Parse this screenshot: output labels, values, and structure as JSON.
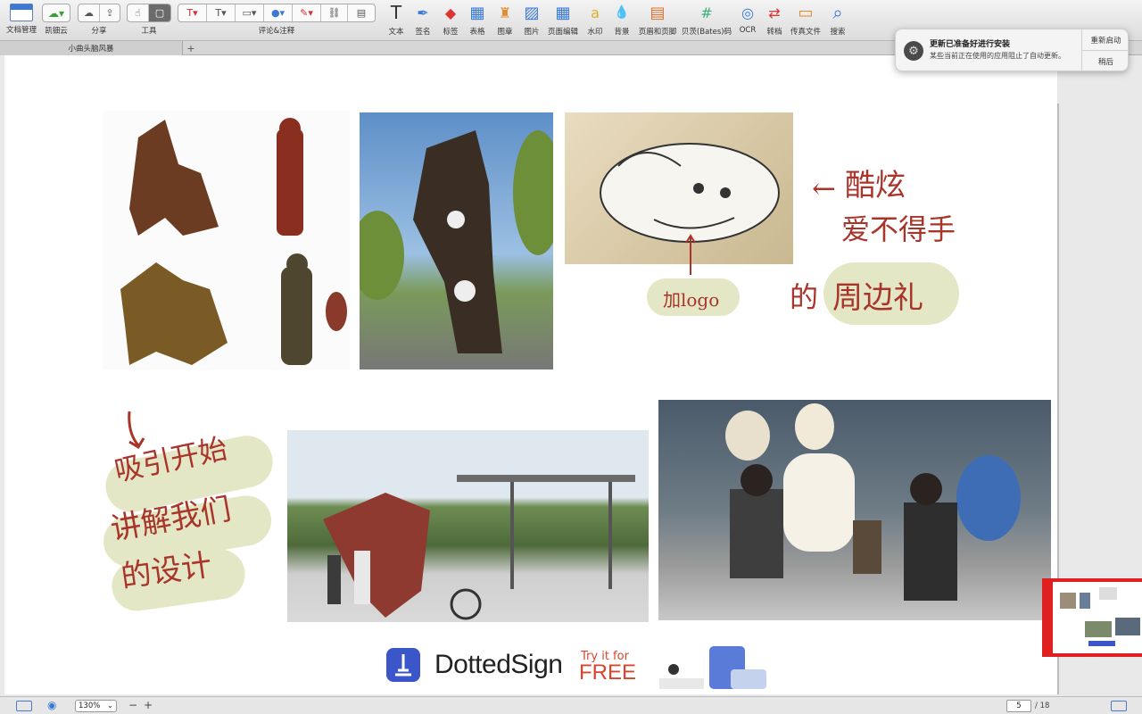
{
  "toolbar": {
    "doc_mgmt": "文档管理",
    "kdan_cloud": "凯钿云",
    "share": "分享",
    "tools": "工具",
    "comment": "评论&注释",
    "tools_right": [
      {
        "label": "文本",
        "icon": "text-icon"
      },
      {
        "label": "签名",
        "icon": "pen-nib-icon"
      },
      {
        "label": "标签",
        "icon": "tag-icon"
      },
      {
        "label": "表格",
        "icon": "table-icon"
      },
      {
        "label": "图章",
        "icon": "stamp-icon"
      },
      {
        "label": "图片",
        "icon": "image-icon"
      },
      {
        "label": "页面编辑",
        "icon": "page-grid-icon"
      },
      {
        "label": "水印",
        "icon": "watermark-icon"
      },
      {
        "label": "背景",
        "icon": "background-drop-icon"
      },
      {
        "label": "页眉和页脚",
        "icon": "header-footer-icon"
      },
      {
        "label": "贝茨(Bates)码",
        "icon": "bates-hash-icon"
      },
      {
        "label": "OCR",
        "icon": "ocr-icon"
      },
      {
        "label": "转档",
        "icon": "convert-icon"
      },
      {
        "label": "传真文件",
        "icon": "fax-icon"
      },
      {
        "label": "搜索",
        "icon": "search-icon"
      }
    ]
  },
  "tab": {
    "title": "小曲头脑风暴",
    "add": "+"
  },
  "notification": {
    "title": "更新已准备好进行安装",
    "body": "某些当前正在使用的应用阻止了自动更新。",
    "restart": "重新启动",
    "later": "稍后"
  },
  "page": {
    "annotations": {
      "cool1": "酷炫",
      "cool2": "爱不得手",
      "arrow_left": "←",
      "merch_a": "的",
      "merch_b": "周边礼",
      "add_logo": "加logo",
      "attract1": "吸引开始",
      "attract2": "讲解我们",
      "attract3": "的设计"
    },
    "ad": {
      "brand": "DottedSign",
      "try": "Try it for",
      "free": "FREE"
    }
  },
  "status": {
    "zoom": "130%",
    "minus": "−",
    "plus": "+",
    "page_current": "5",
    "page_total": "/ 18"
  },
  "colors": {
    "annotation": "#a8342a",
    "highlight": "#e4e7c6",
    "accent_blue": "#3a79d6"
  }
}
